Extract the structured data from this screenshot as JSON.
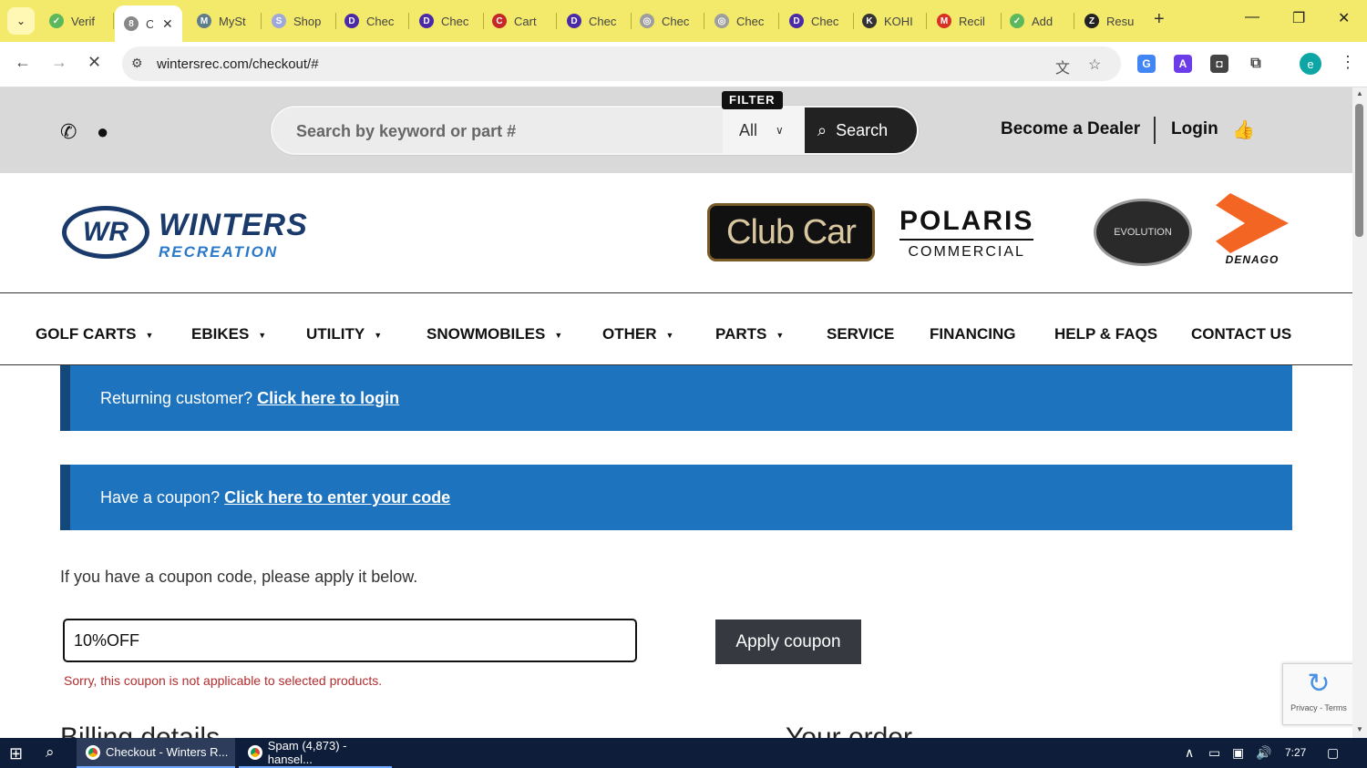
{
  "browser": {
    "tabs": [
      {
        "title": "Verif",
        "color": "#5cb85c",
        "glyph": "✓"
      },
      {
        "title": "C",
        "color": "#888888",
        "glyph": "8",
        "active": true
      },
      {
        "title": "MySt",
        "color": "#607d8b",
        "glyph": "M"
      },
      {
        "title": "Shop",
        "color": "#9fa8da",
        "glyph": "S"
      },
      {
        "title": "Chec",
        "color": "#4b2aa8",
        "glyph": "D"
      },
      {
        "title": "Chec",
        "color": "#4b2aa8",
        "glyph": "D"
      },
      {
        "title": "Cart",
        "color": "#c62828",
        "glyph": "C"
      },
      {
        "title": "Chec",
        "color": "#4b2aa8",
        "glyph": "D"
      },
      {
        "title": "Chec",
        "color": "#9e9e9e",
        "glyph": "◎"
      },
      {
        "title": "Chec",
        "color": "#9e9e9e",
        "glyph": "◎"
      },
      {
        "title": "Chec",
        "color": "#4b2aa8",
        "glyph": "D"
      },
      {
        "title": "KOHI",
        "color": "#333333",
        "glyph": "K"
      },
      {
        "title": "Recil",
        "color": "#d93025",
        "glyph": "M"
      },
      {
        "title": "Add",
        "color": "#5cb85c",
        "glyph": "✓"
      },
      {
        "title": "Resu",
        "color": "#222222",
        "glyph": "Z"
      }
    ],
    "url": "wintersrec.com/checkout/#"
  },
  "site": {
    "search_placeholder": "Search by keyword or part #",
    "filter_label": "FILTER",
    "filter_value": "All",
    "search_button": "Search",
    "become_dealer": "Become a Dealer",
    "login": "Login",
    "logo_main": "WINTERS",
    "logo_sub": "RECREATION",
    "logo_initials": "WR",
    "brands": {
      "clubcar": "Club Car",
      "polaris_1": "POLARIS",
      "polaris_2": "COMMERCIAL",
      "evolution": "EVOLUTION",
      "denago": "DENAGO"
    }
  },
  "nav": [
    {
      "label": "GOLF CARTS",
      "caret": true
    },
    {
      "label": "EBIKES",
      "caret": true
    },
    {
      "label": "UTILITY",
      "caret": true
    },
    {
      "label": "SNOWMOBILES",
      "caret": true
    },
    {
      "label": "OTHER",
      "caret": true
    },
    {
      "label": "PARTS",
      "caret": true
    },
    {
      "label": "SERVICE",
      "caret": false
    },
    {
      "label": "FINANCING",
      "caret": false
    },
    {
      "label": "HELP & FAQS",
      "caret": false
    },
    {
      "label": "CONTACT US",
      "caret": false
    }
  ],
  "checkout": {
    "returning_text": "Returning customer?",
    "returning_link": "Click here to login",
    "coupon_text": "Have a coupon?",
    "coupon_link": "Click here to enter your code",
    "coupon_prompt": "If you have a coupon code, please apply it below.",
    "coupon_value": "10%OFF",
    "apply_button": "Apply coupon",
    "coupon_error": "Sorry, this coupon is not applicable to selected products.",
    "billing_heading": "Billing details",
    "order_heading": "Your order"
  },
  "recaptcha": {
    "links": "Privacy - Terms"
  },
  "taskbar": {
    "task1": "Checkout - Winters R...",
    "task2": "Spam (4,873) - hansel...",
    "time": "7:27"
  },
  "colors": {
    "notice_bg": "#1e73be",
    "notice_border": "#15487a",
    "error": "#b32d2e",
    "button_dark": "#363a40",
    "tabstrip": "#f3e96a"
  }
}
